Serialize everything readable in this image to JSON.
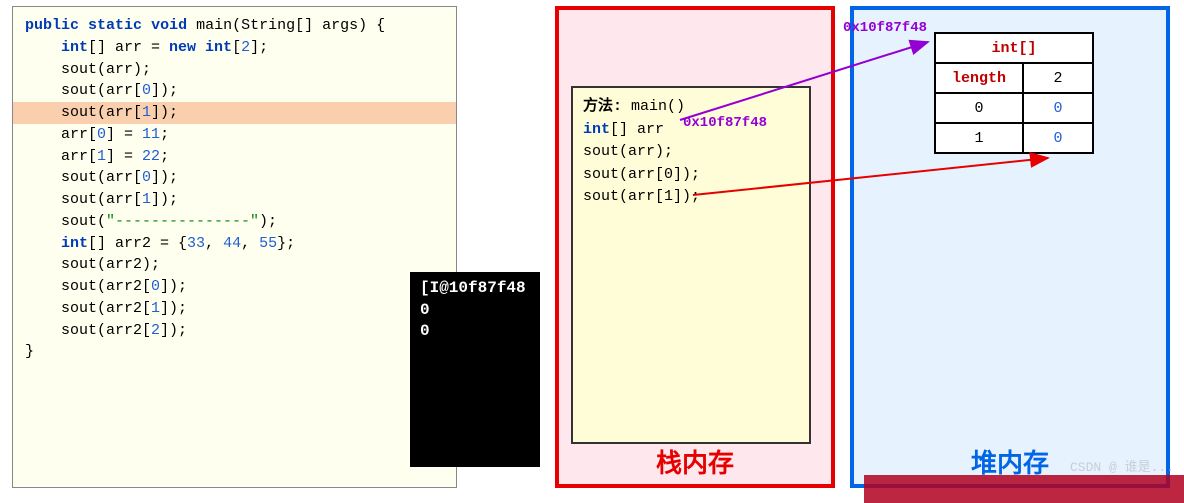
{
  "code": {
    "line1_kw1": "public",
    "line1_kw2": "static",
    "line1_kw3": "void",
    "line1_rest": " main(String[] args) {",
    "line2_kw1": "int",
    "line2_mid": "[] arr = ",
    "line2_kw2": "new",
    "line2_kw3": " int",
    "line2_num": "2",
    "line3": "sout(arr);",
    "line4_a": "sout(arr[",
    "line4_n": "0",
    "line4_b": "]);",
    "line5_a": "sout(arr[",
    "line5_n": "1",
    "line5_b": "]);",
    "blank": "",
    "line6_a": "arr[",
    "line6_n": "0",
    "line6_b": "] = ",
    "line6_v": "11",
    "line7_a": "arr[",
    "line7_n": "1",
    "line7_b": "] = ",
    "line7_v": "22",
    "line8_a": "sout(arr[",
    "line8_n": "0",
    "line8_b": "]);",
    "line9_a": "sout(arr[",
    "line9_n": "1",
    "line9_b": "]);",
    "line10_a": "sout(",
    "line10_s": "\"---------------\"",
    "line10_b": ");",
    "line11_kw": "int",
    "line11_a": "[] arr2 = {",
    "line11_v1": "33",
    "line11_c1": ", ",
    "line11_v2": "44",
    "line11_c2": ", ",
    "line11_v3": "55",
    "line11_b": "};",
    "line12": "sout(arr2);",
    "line13_a": "sout(arr2[",
    "line13_n": "0",
    "line13_b": "]);",
    "line14_a": "sout(arr2[",
    "line14_n": "1",
    "line14_b": "]);",
    "line15_a": "sout(arr2[",
    "line15_n": "2",
    "line15_b": "]);",
    "line16": "}"
  },
  "console": {
    "line1": "[I@10f87f48",
    "line2": "0",
    "line3": "0"
  },
  "stack": {
    "method_label": "方法:",
    "method_name": " main()",
    "l1_kw": "int",
    "l1_rest": "[] arr",
    "l2": "sout(arr);",
    "l3": "sout(arr[0]);",
    "l4": "sout(arr[1]);",
    "title": "栈内存",
    "addr": "0x10f87f48"
  },
  "heap": {
    "title": "堆内存",
    "header": "int[]",
    "length_label": "length",
    "length_val": "2",
    "idx0": "0",
    "val0": "0",
    "idx1": "1",
    "val1": "0",
    "addr": "0x10f87f48"
  },
  "watermark": "CSDN @ 谁是..."
}
